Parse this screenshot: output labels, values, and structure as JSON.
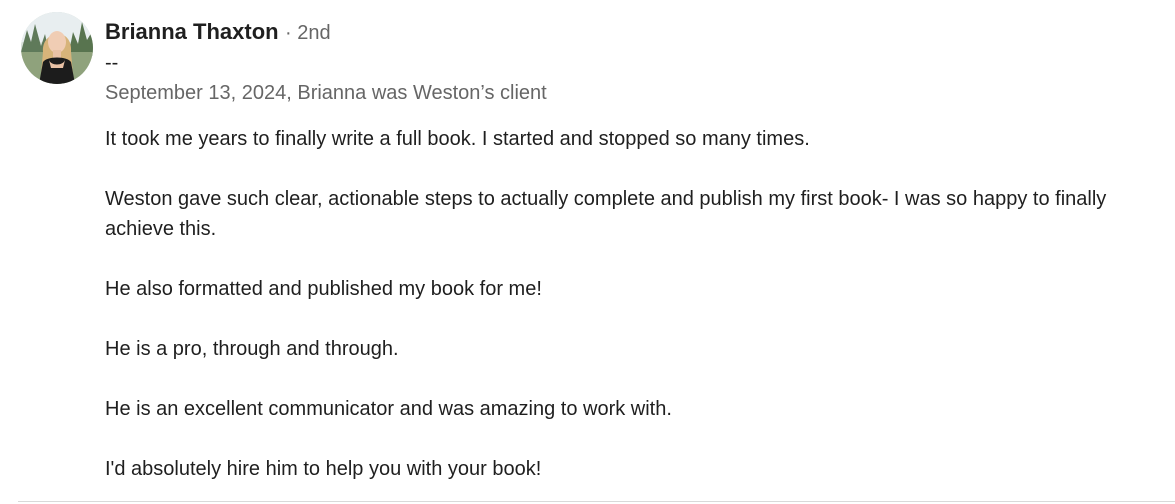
{
  "recommendation": {
    "author": {
      "name": "Brianna Thaxton",
      "degree": "· 2nd",
      "headline": "--",
      "avatar_icon": "profile-photo"
    },
    "meta": "September 13, 2024, Brianna was Weston’s client",
    "paragraphs": [
      "It took me years to finally write a full book. I started and stopped so many times.",
      "Weston gave such clear, actionable steps to actually complete and publish my first book- I was so happy to finally achieve this.",
      "He also formatted and published my book for me!",
      "He is a pro, through and through.",
      "He is an excellent communicator and was amazing to work with.",
      "I'd absolutely hire him to help you with your book!"
    ]
  },
  "colors": {
    "text_primary": "#1f1f1f",
    "text_secondary": "#666666",
    "divider": "#d9d9d9"
  }
}
